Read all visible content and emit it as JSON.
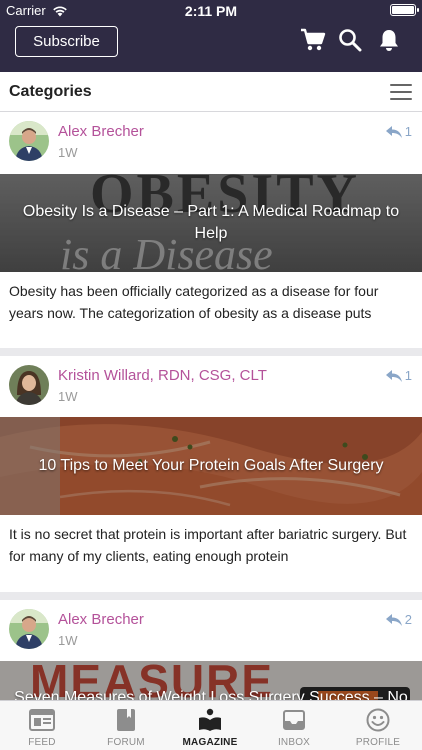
{
  "status": {
    "carrier": "Carrier",
    "time": "2:11 PM"
  },
  "header": {
    "subscribe_label": "Subscribe",
    "icons": [
      "cart-icon",
      "search-icon",
      "bell-icon"
    ]
  },
  "categories": {
    "title": "Categories"
  },
  "posts": [
    {
      "author": "Alex Brecher",
      "age": "1W",
      "reply_count": "1",
      "image_title": "Obesity Is a Disease – Part 1: A Medical Roadmap to Help",
      "image_text": {
        "line1": "OBESITY",
        "line2": "is a Disease"
      },
      "excerpt": "Obesity has been officially categorized as a disease for four years now. The categorization of obesity as a disease puts"
    },
    {
      "author": "Kristin Willard, RDN, CSG, CLT",
      "age": "1W",
      "reply_count": "1",
      "image_title": "10 Tips to Meet Your Protein Goals After Surgery",
      "excerpt": "It is no secret that protein is important after bariatric surgery. But for many of my clients, eating enough protein"
    },
    {
      "author": "Alex Brecher",
      "age": "1W",
      "reply_count": "2",
      "image_title": "Seven Measures of Weight Loss Surgery Success – No",
      "image_text": {
        "line1": "MEASURE"
      }
    }
  ],
  "tabs": [
    {
      "label": "FEED",
      "icon": "feed-icon"
    },
    {
      "label": "FORUM",
      "icon": "forum-icon"
    },
    {
      "label": "MAGAZINE",
      "icon": "magazine-icon",
      "active": true
    },
    {
      "label": "INBOX",
      "icon": "inbox-icon"
    },
    {
      "label": "PROFILE",
      "icon": "profile-icon"
    }
  ],
  "colors": {
    "header_bg": "#2f2b44",
    "author": "#b4529a",
    "reply": "#8aa6c8"
  }
}
